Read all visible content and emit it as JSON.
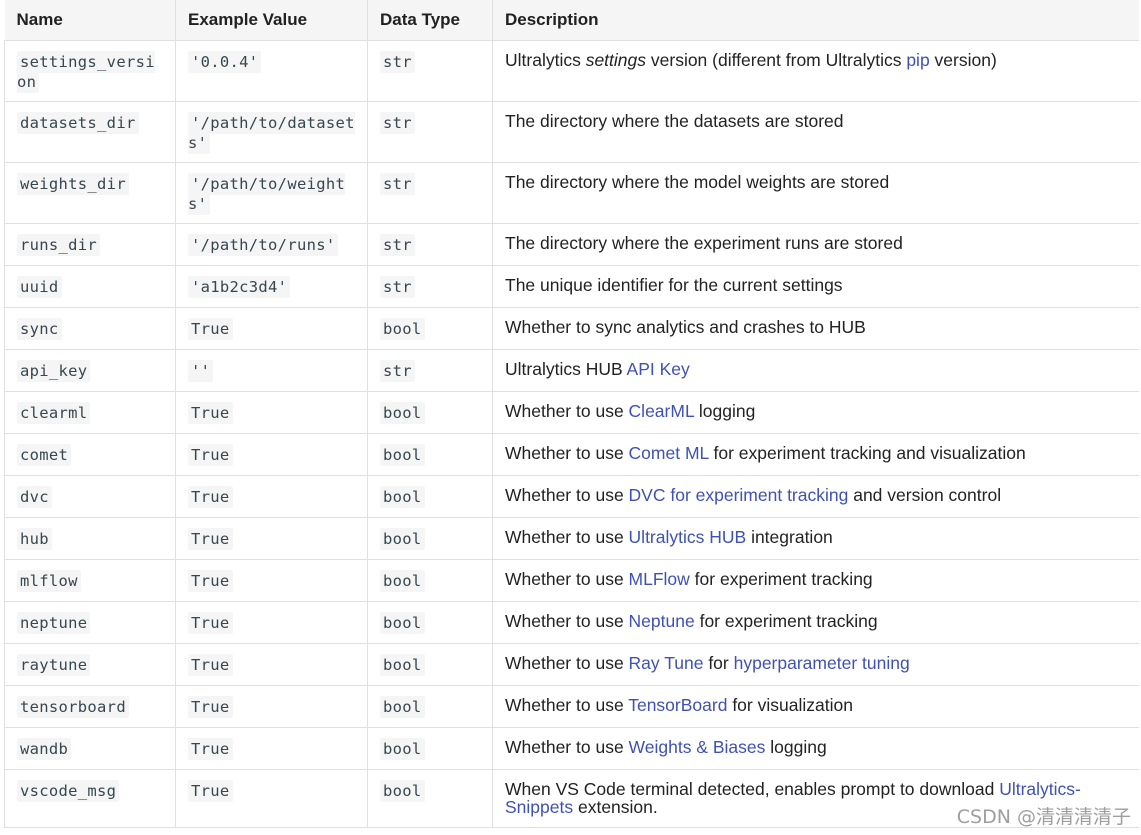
{
  "headers": [
    "Name",
    "Example Value",
    "Data Type",
    "Description"
  ],
  "rows": {
    "r0": {
      "name": "settings_version",
      "value": "'0.0.4'",
      "type": "str",
      "d1": "Ultralytics ",
      "d2": "settings",
      "d3": " version (different from Ultralytics ",
      "link1": "pip",
      "d4": " version)"
    },
    "r1": {
      "name": "datasets_dir",
      "value": "'/path/to/datasets'",
      "type": "str",
      "d1": "The directory where the datasets are stored"
    },
    "r2": {
      "name": "weights_dir",
      "value": "'/path/to/weights'",
      "type": "str",
      "d1": "The directory where the model weights are stored"
    },
    "r3": {
      "name": "runs_dir",
      "value": "'/path/to/runs'",
      "type": "str",
      "d1": "The directory where the experiment runs are stored"
    },
    "r4": {
      "name": "uuid",
      "value": "'a1b2c3d4'",
      "type": "str",
      "d1": "The unique identifier for the current settings"
    },
    "r5": {
      "name": "sync",
      "value": "True",
      "type": "bool",
      "d1": "Whether to sync analytics and crashes to HUB"
    },
    "r6": {
      "name": "api_key",
      "value": "''",
      "type": "str",
      "d1": "Ultralytics HUB ",
      "link1": "API Key"
    },
    "r7": {
      "name": "clearml",
      "value": "True",
      "type": "bool",
      "d1": "Whether to use ",
      "link1": "ClearML",
      "d2": " logging"
    },
    "r8": {
      "name": "comet",
      "value": "True",
      "type": "bool",
      "d1": "Whether to use ",
      "link1": "Comet ML",
      "d2": " for experiment tracking and visualization"
    },
    "r9": {
      "name": "dvc",
      "value": "True",
      "type": "bool",
      "d1": "Whether to use ",
      "link1": "DVC for experiment tracking",
      "d2": " and version control"
    },
    "r10": {
      "name": "hub",
      "value": "True",
      "type": "bool",
      "d1": "Whether to use ",
      "link1": "Ultralytics HUB",
      "d2": " integration"
    },
    "r11": {
      "name": "mlflow",
      "value": "True",
      "type": "bool",
      "d1": "Whether to use ",
      "link1": "MLFlow",
      "d2": " for experiment tracking"
    },
    "r12": {
      "name": "neptune",
      "value": "True",
      "type": "bool",
      "d1": "Whether to use ",
      "link1": "Neptune",
      "d2": " for experiment tracking"
    },
    "r13": {
      "name": "raytune",
      "value": "True",
      "type": "bool",
      "d1": "Whether to use ",
      "link1": "Ray Tune",
      "d2": " for ",
      "link2": "hyperparameter tuning"
    },
    "r14": {
      "name": "tensorboard",
      "value": "True",
      "type": "bool",
      "d1": "Whether to use ",
      "link1": "TensorBoard",
      "d2": " for visualization"
    },
    "r15": {
      "name": "wandb",
      "value": "True",
      "type": "bool",
      "d1": "Whether to use ",
      "link1": "Weights & Biases",
      "d2": " logging"
    },
    "r16": {
      "name": "vscode_msg",
      "value": "True",
      "type": "bool",
      "d1": "When VS Code terminal detected, enables prompt to download ",
      "link1": "Ultralytics-Snippets",
      "d2": " extension."
    }
  },
  "watermark": "CSDN @清清清清子"
}
